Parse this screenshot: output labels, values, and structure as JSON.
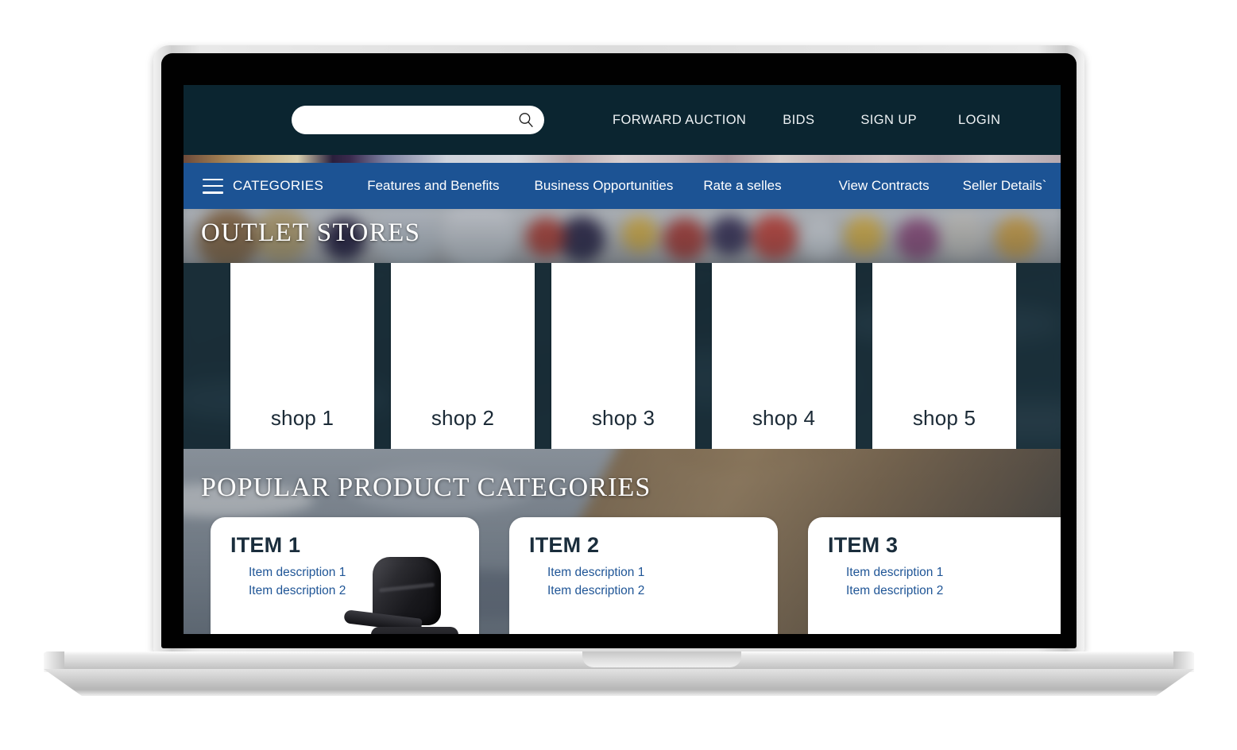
{
  "device": {
    "type": "laptop-mockup",
    "frame_color": "#dcdcdc",
    "bezel_color": "#010101"
  },
  "site": {
    "header": {
      "background": "#0b2530",
      "search": {
        "placeholder": "",
        "value": "",
        "icon": "search-icon"
      },
      "nav_links": [
        {
          "label": "FORWARD AUCTION"
        },
        {
          "label": "BIDS"
        },
        {
          "label": "SIGN UP"
        },
        {
          "label": "LOGIN"
        }
      ]
    },
    "nav": {
      "background": "#1c5394",
      "menu_icon": "hamburger-icon",
      "categories_label": "CATEGORIES",
      "links": [
        {
          "label": "Features and Benefits"
        },
        {
          "label": "Business Opportunities"
        },
        {
          "label": "Rate a selles"
        },
        {
          "label": "View Contracts"
        },
        {
          "label": "Seller Details`"
        }
      ]
    },
    "outlet": {
      "title": "OUTLET STORES",
      "shops": [
        {
          "label": "shop 1"
        },
        {
          "label": "shop 2"
        },
        {
          "label": "shop 3"
        },
        {
          "label": "shop 4"
        },
        {
          "label": "shop 5"
        }
      ]
    },
    "popular": {
      "title": "POPULAR PRODUCT CATEGORIES",
      "items": [
        {
          "title": "ITEM 1",
          "desc1": "Item description 1",
          "desc2": "Item description 2",
          "image": "office-chair-photo"
        },
        {
          "title": "ITEM 2",
          "desc1": "Item description 1",
          "desc2": "Item description 2",
          "image": ""
        },
        {
          "title": "ITEM 3",
          "desc1": "Item description 1",
          "desc2": "Item description 2",
          "image": ""
        }
      ]
    }
  }
}
